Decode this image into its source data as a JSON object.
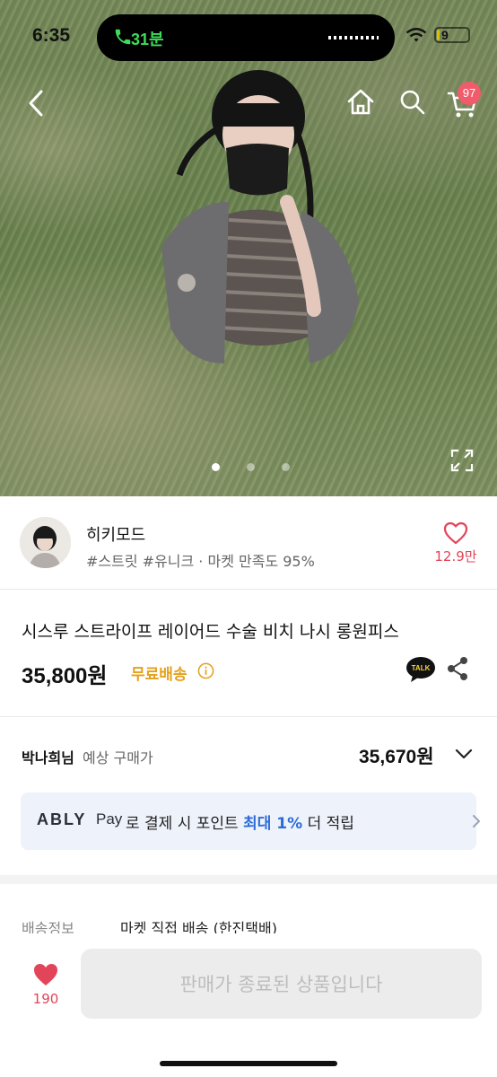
{
  "status_bar": {
    "time": "6:35",
    "call_duration": "31분",
    "battery": "9"
  },
  "header": {
    "cart_badge": "97"
  },
  "gallery": {
    "page_count": 3,
    "active_index": 0
  },
  "seller": {
    "name": "히키모드",
    "tags": "#스트릿 #유니크 · 마켓 만족도 95%",
    "follow_count": "12.9만"
  },
  "product": {
    "title": "시스루 스트라이프 레이어드 수술 비치 나시 롱원피스",
    "price": "35,800원",
    "shipping_badge": "무료배송"
  },
  "expected_price": {
    "user": "박나희님",
    "label": "예상 구매가",
    "price": "35,670원"
  },
  "ably_pay": {
    "logo": "ABLY",
    "pay": "Pay",
    "text_before": "로 결제 시 포인트 ",
    "highlight": "최대 1%",
    "text_after": " 더 적립"
  },
  "shipping": {
    "label": "배송정보",
    "value": "마켓 직접 배송 (한진택배)"
  },
  "bottom": {
    "like_count": "190",
    "buy_label": "판매가 종료된 상품입니다"
  },
  "colors": {
    "accent_red": "#e2455a",
    "shipping_orange": "#e4a11b",
    "highlight_blue": "#2c6bd9"
  }
}
